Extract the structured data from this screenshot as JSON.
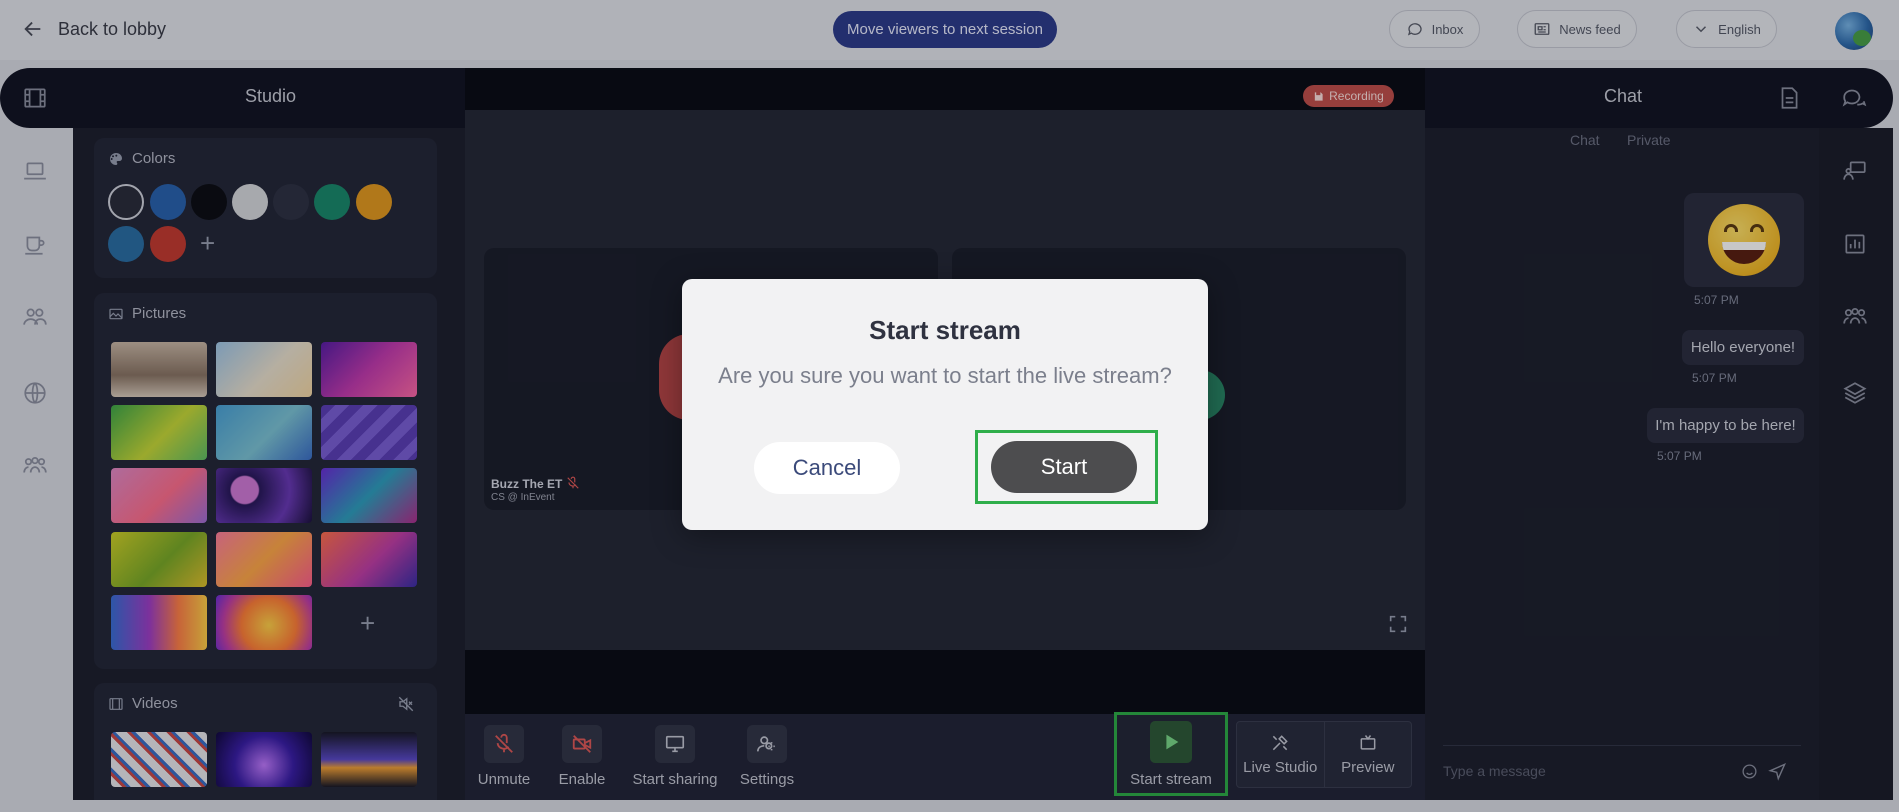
{
  "topbar": {
    "back_label": "Back to lobby",
    "move_viewers_label": "Move viewers to next session",
    "inbox_label": "Inbox",
    "news_feed_label": "News feed",
    "language_label": "English"
  },
  "studio": {
    "title": "Studio",
    "colors_title": "Colors",
    "pictures_title": "Pictures",
    "videos_title": "Videos",
    "color_swatches": [
      "#2b2e3d",
      "#2a63b0",
      "#0d0f17",
      "#d7d9de",
      "#2f3346",
      "#1a8a6d",
      "#e39a22",
      "#2b6fa6",
      "#c43c32"
    ]
  },
  "stage": {
    "recording_label": "Recording",
    "participant_name": "Buzz The ET",
    "participant_org": "CS @ InEvent"
  },
  "controls": {
    "unmute": "Unmute",
    "enable": "Enable",
    "start_sharing": "Start sharing",
    "settings": "Settings",
    "start_stream": "Start stream",
    "live_studio": "Live Studio",
    "preview": "Preview"
  },
  "chat": {
    "title": "Chat",
    "tab_chat": "Chat",
    "tab_private": "Private",
    "messages": [
      {
        "text": "😄",
        "time": "5:07 PM"
      },
      {
        "text": "Hello everyone!",
        "time": "5:07 PM"
      },
      {
        "text": "I'm happy to be here!",
        "time": "5:07 PM"
      }
    ],
    "input_placeholder": "Type a message"
  },
  "modal": {
    "title": "Start stream",
    "text": "Are you sure you want to start the live stream?",
    "cancel_label": "Cancel",
    "start_label": "Start"
  }
}
